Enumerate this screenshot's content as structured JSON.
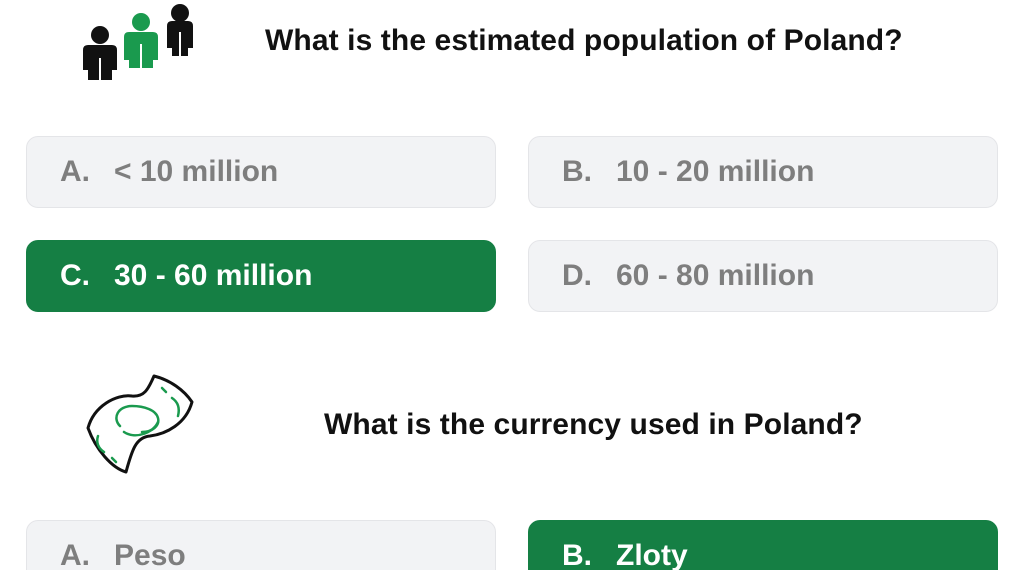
{
  "colors": {
    "correct_bg": "#157f44",
    "option_bg": "#f2f3f5",
    "option_text": "#7e7e7e",
    "icon_green": "#1a9a4e",
    "icon_black": "#111111"
  },
  "questions": [
    {
      "icon": "people-icon",
      "text": "What is the estimated population of Poland?",
      "options": [
        {
          "letter": "A.",
          "label": "< 10 million",
          "correct": false
        },
        {
          "letter": "B.",
          "label": "10 - 20 million",
          "correct": false
        },
        {
          "letter": "C.",
          "label": "30 - 60 million",
          "correct": true
        },
        {
          "letter": "D.",
          "label": "60 - 80 million",
          "correct": false
        }
      ]
    },
    {
      "icon": "banknote-icon",
      "text": "What is the currency used in Poland?",
      "options": [
        {
          "letter": "A.",
          "label": "Peso",
          "correct": false
        },
        {
          "letter": "B.",
          "label": "Zloty",
          "correct": true
        }
      ]
    }
  ]
}
